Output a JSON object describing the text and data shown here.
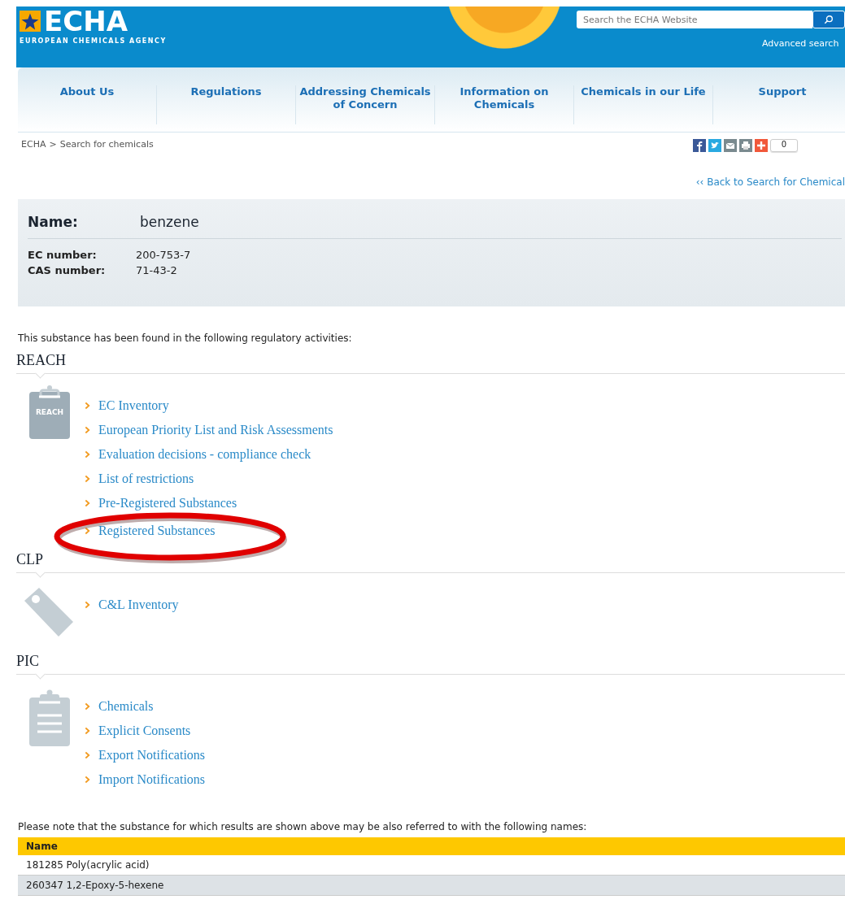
{
  "header": {
    "logo_text": "ECHA",
    "logo_subtitle": "EUROPEAN CHEMICALS AGENCY",
    "search": {
      "placeholder": "Search the ECHA Website"
    },
    "advanced_search": "Advanced search"
  },
  "nav": [
    {
      "label": "About Us"
    },
    {
      "label": "Regulations"
    },
    {
      "label": "Addressing Chemicals of Concern"
    },
    {
      "label": "Information on Chemicals"
    },
    {
      "label": "Chemicals in our Life"
    },
    {
      "label": "Support"
    }
  ],
  "breadcrumb": {
    "items": [
      "ECHA",
      "Search for chemicals"
    ],
    "separator": ">"
  },
  "share": {
    "count": "0"
  },
  "back_link": "‹‹ Back to Search for Chemical",
  "substance": {
    "name_label": "Name:",
    "name": "benzene",
    "fields": [
      {
        "label": "EC number:",
        "value": "200-753-7"
      },
      {
        "label": "CAS number:",
        "value": "71-43-2"
      }
    ]
  },
  "intro": "This substance has been found in the following regulatory activities:",
  "sections": [
    {
      "title": "REACH",
      "kind": "reach",
      "icon_label": "REACH",
      "links": [
        {
          "label": "EC Inventory",
          "highlighted": false
        },
        {
          "label": "European Priority List and Risk Assessments",
          "highlighted": false
        },
        {
          "label": "Evaluation decisions - compliance check",
          "highlighted": false
        },
        {
          "label": "List of restrictions",
          "highlighted": false
        },
        {
          "label": "Pre-Registered Substances",
          "highlighted": false
        },
        {
          "label": "Registered Substances",
          "highlighted": true
        }
      ]
    },
    {
      "title": "CLP",
      "kind": "clp",
      "links": [
        {
          "label": "C&L Inventory",
          "highlighted": false
        }
      ]
    },
    {
      "title": "PIC",
      "kind": "pic",
      "links": [
        {
          "label": "Chemicals",
          "highlighted": false
        },
        {
          "label": "Explicit Consents",
          "highlighted": false
        },
        {
          "label": "Export Notifications",
          "highlighted": false
        },
        {
          "label": "Import Notifications",
          "highlighted": false
        }
      ]
    }
  ],
  "note": "Please note that the substance for which results are shown above may be also referred to with the following names:",
  "names_table": {
    "columns": [
      "Name"
    ],
    "rows": [
      "181285 Poly(acrylic acid)",
      "260347 1,2-Epoxy-5-hexene"
    ]
  }
}
